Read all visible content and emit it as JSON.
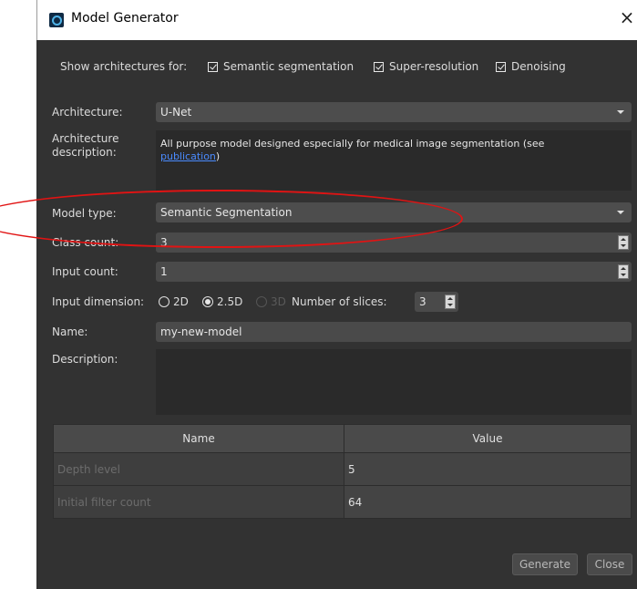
{
  "window": {
    "title": "Model Generator",
    "close": "×"
  },
  "show_arch": {
    "label": "Show architectures for:",
    "options": [
      {
        "label": "Semantic segmentation",
        "checked": true
      },
      {
        "label": "Super-resolution",
        "checked": true
      },
      {
        "label": "Denoising",
        "checked": true
      }
    ]
  },
  "architecture": {
    "label": "Architecture:",
    "value": "U-Net"
  },
  "arch_desc": {
    "label": "Architecture description:",
    "text": "All purpose model designed especially for medical image segmentation (see",
    "link": "publication",
    "suffix": ")"
  },
  "model_type": {
    "label": "Model type:",
    "value": "Semantic Segmentation"
  },
  "class_count": {
    "label": "Class count:",
    "value": "3"
  },
  "input_count": {
    "label": "Input count:",
    "value": "1"
  },
  "input_dim": {
    "label": "Input dimension:",
    "options": [
      {
        "label": "2D",
        "checked": false,
        "enabled": true
      },
      {
        "label": "2.5D",
        "checked": true,
        "enabled": true
      },
      {
        "label": "3D",
        "checked": false,
        "enabled": false
      }
    ],
    "slices_label": "Number of slices:",
    "slices_value": "3"
  },
  "name": {
    "label": "Name:",
    "value": "my-new-model"
  },
  "description": {
    "label": "Description:",
    "value": ""
  },
  "params_table": {
    "headers": [
      "Name",
      "Value"
    ],
    "rows": [
      {
        "name": "Depth level",
        "value": "5"
      },
      {
        "name": "Initial filter count",
        "value": "64"
      }
    ]
  },
  "buttons": {
    "generate": "Generate",
    "close": "Close"
  },
  "colors": {
    "dialog_bg": "#323232",
    "annotation": "#e11313",
    "link": "#4a8bff"
  }
}
